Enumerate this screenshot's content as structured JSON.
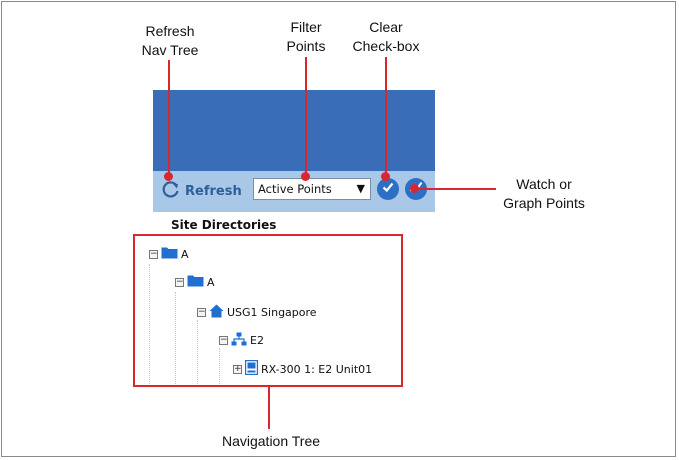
{
  "callouts": {
    "refresh": [
      "Refresh",
      "Nav Tree"
    ],
    "filter": [
      "Filter",
      "Points"
    ],
    "clear": [
      "Clear",
      "Check-box"
    ],
    "watch": [
      "Watch or",
      "Graph Points"
    ],
    "navigation_tree": "Navigation Tree"
  },
  "toolbar": {
    "refresh_label": "Refresh",
    "filter_selected": "Active Points",
    "filter_arrow": "▼"
  },
  "panel": {
    "section_title": "Site Directories"
  },
  "tree": {
    "items": [
      {
        "label": "A",
        "icon": "folder-icon",
        "level": 0
      },
      {
        "label": "A",
        "icon": "folder-icon",
        "level": 1
      },
      {
        "label": "USG1 Singapore",
        "icon": "house-icon",
        "level": 2
      },
      {
        "label": "E2",
        "icon": "network-icon",
        "level": 3
      },
      {
        "label": "RX-300 1: E2 Unit01",
        "icon": "device-icon",
        "level": 4
      }
    ]
  },
  "colors": {
    "accent_red": "#d9272e",
    "panel_blue": "#3a6db8",
    "toolbar_blue": "#a9c8e8",
    "icon_blue": "#1f6fd1"
  }
}
